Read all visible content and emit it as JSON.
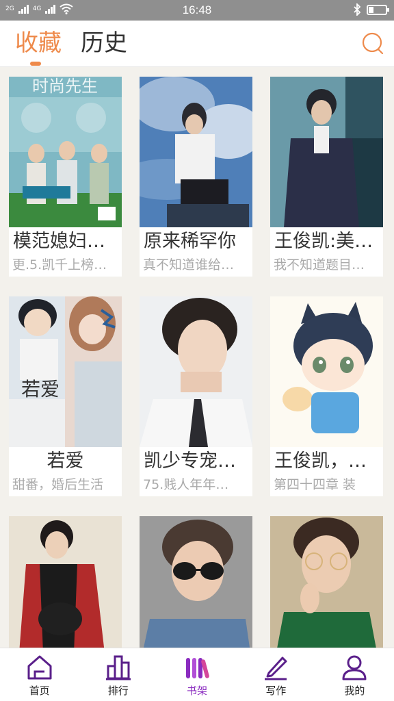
{
  "status": {
    "network_label_1": "2G",
    "network_label_2": "4G",
    "time": "16:48",
    "battery_level": 0.3
  },
  "header": {
    "tabs": [
      {
        "label": "收藏",
        "active": true
      },
      {
        "label": "历史",
        "active": false
      }
    ],
    "search_icon": "search-icon",
    "accent_color": "#ee8a4b"
  },
  "books": [
    {
      "title": "模范媳妇…",
      "desc": "更.5.凯千上榜…",
      "cover_text": "时尚先生"
    },
    {
      "title": "原来稀罕你",
      "desc": "真不知道谁给…"
    },
    {
      "title": "王俊凯:美…",
      "desc": "我不知道题目…"
    },
    {
      "title": "若爱",
      "desc": "甜番，婚后生活",
      "cover_text": "若爱"
    },
    {
      "title": "凯少专宠…",
      "desc": "75.贱人年年…"
    },
    {
      "title": "王俊凯，…",
      "desc": "第四十四章 装"
    },
    {
      "title": "",
      "desc": ""
    },
    {
      "title": "",
      "desc": ""
    },
    {
      "title": "",
      "desc": ""
    }
  ],
  "bottom_nav": [
    {
      "label": "首页",
      "icon": "home-icon",
      "active": false
    },
    {
      "label": "排行",
      "icon": "ranking-icon",
      "active": false
    },
    {
      "label": "书架",
      "icon": "bookshelf-icon",
      "active": true
    },
    {
      "label": "写作",
      "icon": "pen-icon",
      "active": false
    },
    {
      "label": "我的",
      "icon": "user-icon",
      "active": false
    }
  ],
  "nav_active_color": "#8a2bbf"
}
